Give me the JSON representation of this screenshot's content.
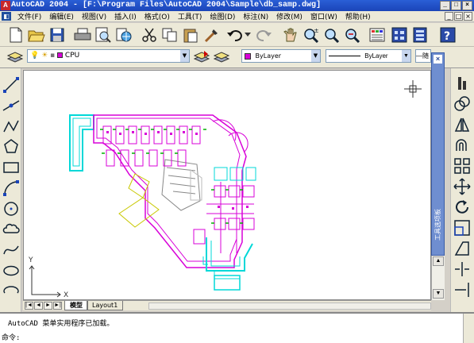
{
  "window": {
    "title": "AutoCAD 2004 - [F:\\Program Files\\AutoCAD 2004\\Sample\\db_samp.dwg]",
    "app_icon": "autocad-icon",
    "controls": [
      "_",
      "□",
      "×"
    ]
  },
  "menu": {
    "items": [
      "文件(F)",
      "编辑(E)",
      "视图(V)",
      "插入(I)",
      "格式(O)",
      "工具(T)",
      "绘图(D)",
      "标注(N)",
      "修改(M)",
      "窗口(W)",
      "帮助(H)"
    ],
    "doc_controls": [
      "_",
      "□",
      "×"
    ]
  },
  "properties_toolbar": {
    "layer": "CPU",
    "color": "ByLayer",
    "linetype": "ByLayer",
    "lineweight": "—随"
  },
  "tool_palette": {
    "title": "工具选项板",
    "close": "×"
  },
  "layout_tabs": [
    "模型",
    "Layout1"
  ],
  "nav_buttons": [
    "◄◄",
    "◄",
    "►",
    "►►"
  ],
  "command": {
    "history": "AutoCAD 菜单实用程序已加载。",
    "prompt": "命令:"
  },
  "ucs": {
    "x_label": "X",
    "y_label": "Y"
  },
  "colors": {
    "title_bar": "#1a44b8",
    "drawing_magenta": "#d800d8",
    "drawing_cyan": "#00d8d8",
    "drawing_green": "#00b000",
    "drawing_yellow": "#c8c800"
  }
}
